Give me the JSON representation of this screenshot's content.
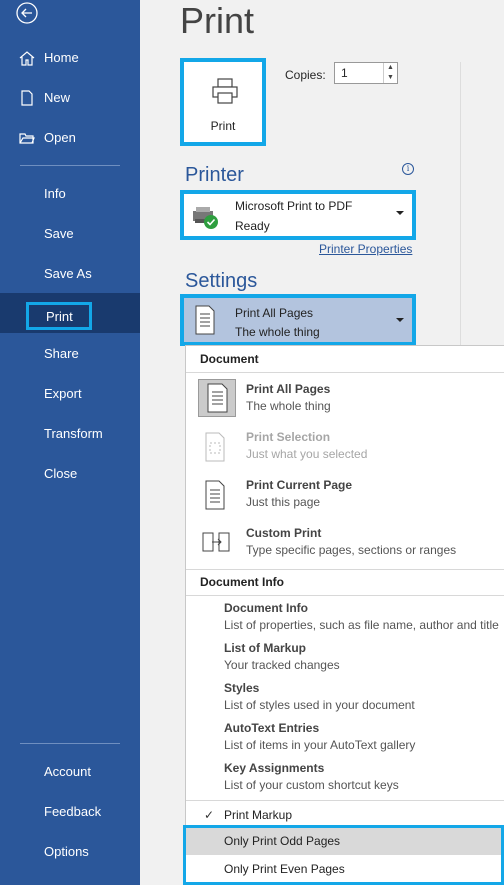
{
  "sidebar": {
    "items_top": [
      {
        "label": "Home",
        "icon": "home-icon"
      },
      {
        "label": "New",
        "icon": "new-document-icon"
      },
      {
        "label": "Open",
        "icon": "open-folder-icon"
      }
    ],
    "items_mid": [
      "Info",
      "Save",
      "Save As",
      "Print",
      "Share",
      "Export",
      "Transform",
      "Close"
    ],
    "items_bottom": [
      "Account",
      "Feedback",
      "Options"
    ]
  },
  "main": {
    "title": "Print",
    "print_button_label": "Print",
    "copies_label": "Copies:",
    "copies_value": "1",
    "printer_section": "Printer",
    "printer_name": "Microsoft Print to PDF",
    "printer_status": "Ready",
    "printer_properties": "Printer Properties",
    "settings_section": "Settings",
    "settings_selected_title": "Print All Pages",
    "settings_selected_desc": "The whole thing"
  },
  "menu": {
    "document_header": "Document",
    "doc_items": [
      {
        "title": "Print All Pages",
        "desc": "The whole thing",
        "state": "selected"
      },
      {
        "title": "Print Selection",
        "desc": "Just what you selected",
        "state": "disabled"
      },
      {
        "title": "Print Current Page",
        "desc": "Just this page",
        "state": "normal"
      },
      {
        "title": "Custom Print",
        "desc": "Type specific pages, sections or ranges",
        "state": "normal"
      }
    ],
    "docinfo_header": "Document Info",
    "info_items": [
      {
        "title": "Document Info",
        "desc": "List of properties, such as file name, author and title"
      },
      {
        "title": "List of Markup",
        "desc": "Your tracked changes"
      },
      {
        "title": "Styles",
        "desc": "List of styles used in your document"
      },
      {
        "title": "AutoText Entries",
        "desc": "List of items in your AutoText gallery"
      },
      {
        "title": "Key Assignments",
        "desc": "List of your custom shortcut keys"
      }
    ],
    "print_markup": "Print Markup",
    "odd_pages": "Only Print Odd Pages",
    "even_pages": "Only Print Even Pages"
  },
  "colors": {
    "sidebar": "#2b579a",
    "highlight": "#13a7e8",
    "selected_nav": "#193a6e"
  }
}
